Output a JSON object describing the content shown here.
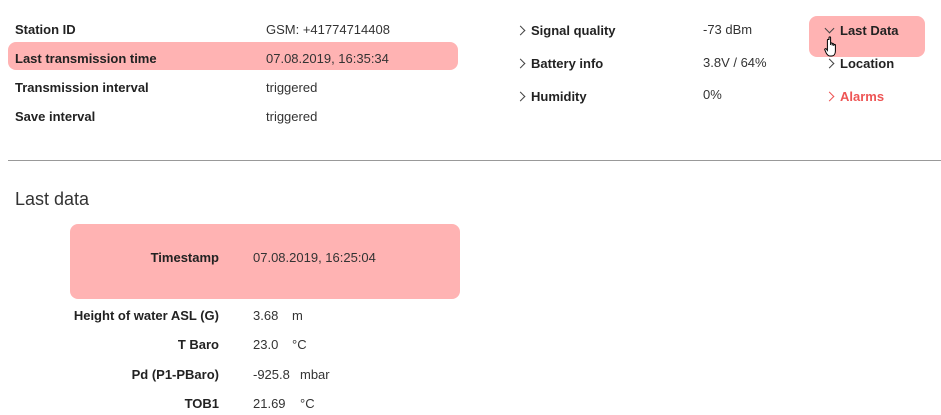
{
  "station": {
    "rows": [
      {
        "label": "Station ID",
        "value": "GSM: +41774714408"
      },
      {
        "label": "Last transmission time",
        "value": "07.08.2019, 16:35:34"
      },
      {
        "label": "Transmission interval",
        "value": "triggered"
      },
      {
        "label": "Save interval",
        "value": "triggered"
      }
    ]
  },
  "status": {
    "rows": [
      {
        "label": "Signal quality",
        "value": "-73 dBm",
        "icon": "chevron-right-icon"
      },
      {
        "label": "Battery info",
        "value": "3.8V / 64%",
        "icon": "chevron-right-icon"
      },
      {
        "label": "Humidity",
        "value": "0%",
        "icon": "chevron-right-icon"
      }
    ]
  },
  "nav": {
    "items": [
      {
        "label": "Last Data",
        "icon": "chevron-down-icon",
        "expanded": true
      },
      {
        "label": "Location",
        "icon": "chevron-right-icon"
      },
      {
        "label": "Alarms",
        "icon": "chevron-right-icon",
        "color": "#ee5555"
      }
    ]
  },
  "last_data": {
    "title": "Last data",
    "timestamp": {
      "label": "Timestamp",
      "value": "07.08.2019, 16:25:04"
    },
    "rows": [
      {
        "label": "Height of water ASL (G)",
        "value": "3.68",
        "unit": "m"
      },
      {
        "label": "T Baro",
        "value": "23.0",
        "unit": "°C"
      },
      {
        "label": "Pd (P1-PBaro)",
        "value": "-925.8",
        "unit": "mbar"
      },
      {
        "label": "TOB1",
        "value": "21.69",
        "unit": "°C"
      }
    ]
  },
  "colors": {
    "highlight": "#ffb3b3",
    "alarm": "#ee5555"
  }
}
